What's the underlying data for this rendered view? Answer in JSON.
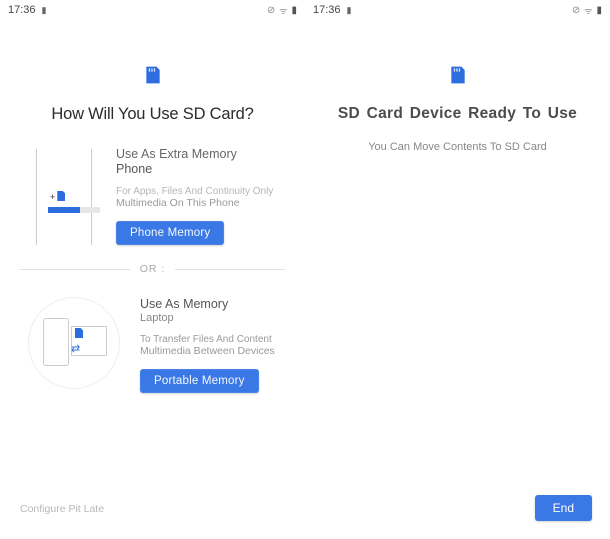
{
  "status": {
    "time": "17:36",
    "icons": {
      "sd": "▮",
      "data": "⊘",
      "wifi": "ᯤ",
      "battery": "▮"
    }
  },
  "left": {
    "title": "How Will You Use SD Card?",
    "option1": {
      "heading": "Use As Extra Memory",
      "sub": "Phone",
      "desc1": "For Apps, Files And Continuity Only",
      "desc2": "Multimedia On This Phone",
      "button": "Phone Memory",
      "plus": "+"
    },
    "divider": "OR :",
    "option2": {
      "heading": "Use As Memory",
      "sub": "Laptop",
      "desc1": "To Transfer Files And Content",
      "desc2": "Multimedia Between Devices",
      "button": "Portable Memory"
    },
    "footer": "Configure Pit Late"
  },
  "right": {
    "title": "SD Card Device Ready To Use",
    "subtitle": "You Can Move Contents To SD Card",
    "button": "End"
  },
  "colors": {
    "accent": "#3a78e6"
  }
}
